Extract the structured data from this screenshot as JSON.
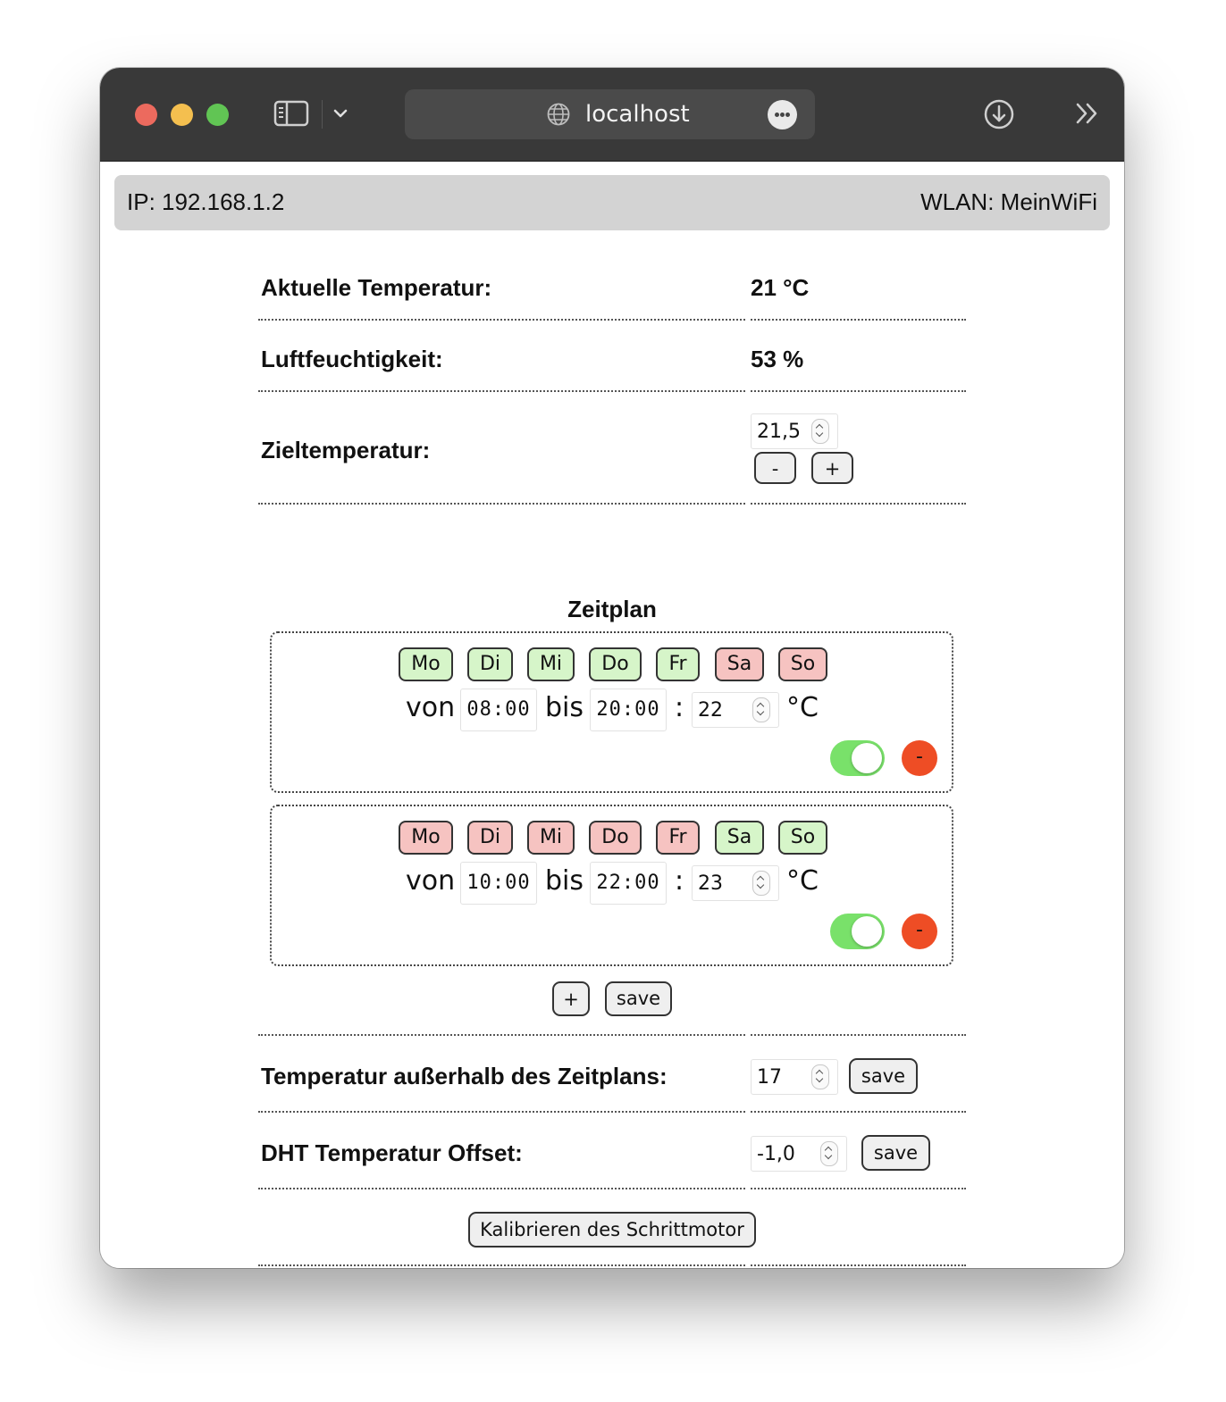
{
  "browser": {
    "url": "localhost"
  },
  "status": {
    "ip": "IP: 192.168.1.2",
    "wlan": "WLAN: MeinWiFi"
  },
  "readings": {
    "temp_label": "Aktuelle Temperatur:",
    "temp_value": "21 °C",
    "humidity_label": "Luftfeuchtigkeit:",
    "humidity_value": "53 %"
  },
  "target": {
    "label": "Zieltemperatur:",
    "value": "21,5",
    "minus": "-",
    "plus": "+"
  },
  "schedule": {
    "title": "Zeitplan",
    "entries": [
      {
        "days": [
          {
            "label": "Mo",
            "active": true
          },
          {
            "label": "Di",
            "active": true
          },
          {
            "label": "Mi",
            "active": true
          },
          {
            "label": "Do",
            "active": true
          },
          {
            "label": "Fr",
            "active": true
          },
          {
            "label": "Sa",
            "active": false
          },
          {
            "label": "So",
            "active": false
          }
        ],
        "from_word": "von",
        "from": "08:00",
        "to_word": "bis",
        "to": "20:00",
        "colon": ":",
        "temp": "22",
        "unit": "°C",
        "enabled": true,
        "remove": "-"
      },
      {
        "days": [
          {
            "label": "Mo",
            "active": false
          },
          {
            "label": "Di",
            "active": false
          },
          {
            "label": "Mi",
            "active": false
          },
          {
            "label": "Do",
            "active": false
          },
          {
            "label": "Fr",
            "active": false
          },
          {
            "label": "Sa",
            "active": true
          },
          {
            "label": "So",
            "active": true
          }
        ],
        "from_word": "von",
        "from": "10:00",
        "to_word": "bis",
        "to": "22:00",
        "colon": ":",
        "temp": "23",
        "unit": "°C",
        "enabled": true,
        "remove": "-"
      }
    ],
    "add": "+",
    "save": "save"
  },
  "outside": {
    "label": "Temperatur außerhalb des Zeitplans:",
    "value": "17",
    "save": "save"
  },
  "offset": {
    "label": "DHT Temperatur Offset:",
    "value": "-1,0",
    "save": "save"
  },
  "calibrate": "Kalibrieren des Schrittmotor",
  "colors": {
    "day_active": "#d6f5c9",
    "day_inactive": "#f6c3c1",
    "toggle_on": "#79e16a",
    "remove": "#ee4d25"
  }
}
